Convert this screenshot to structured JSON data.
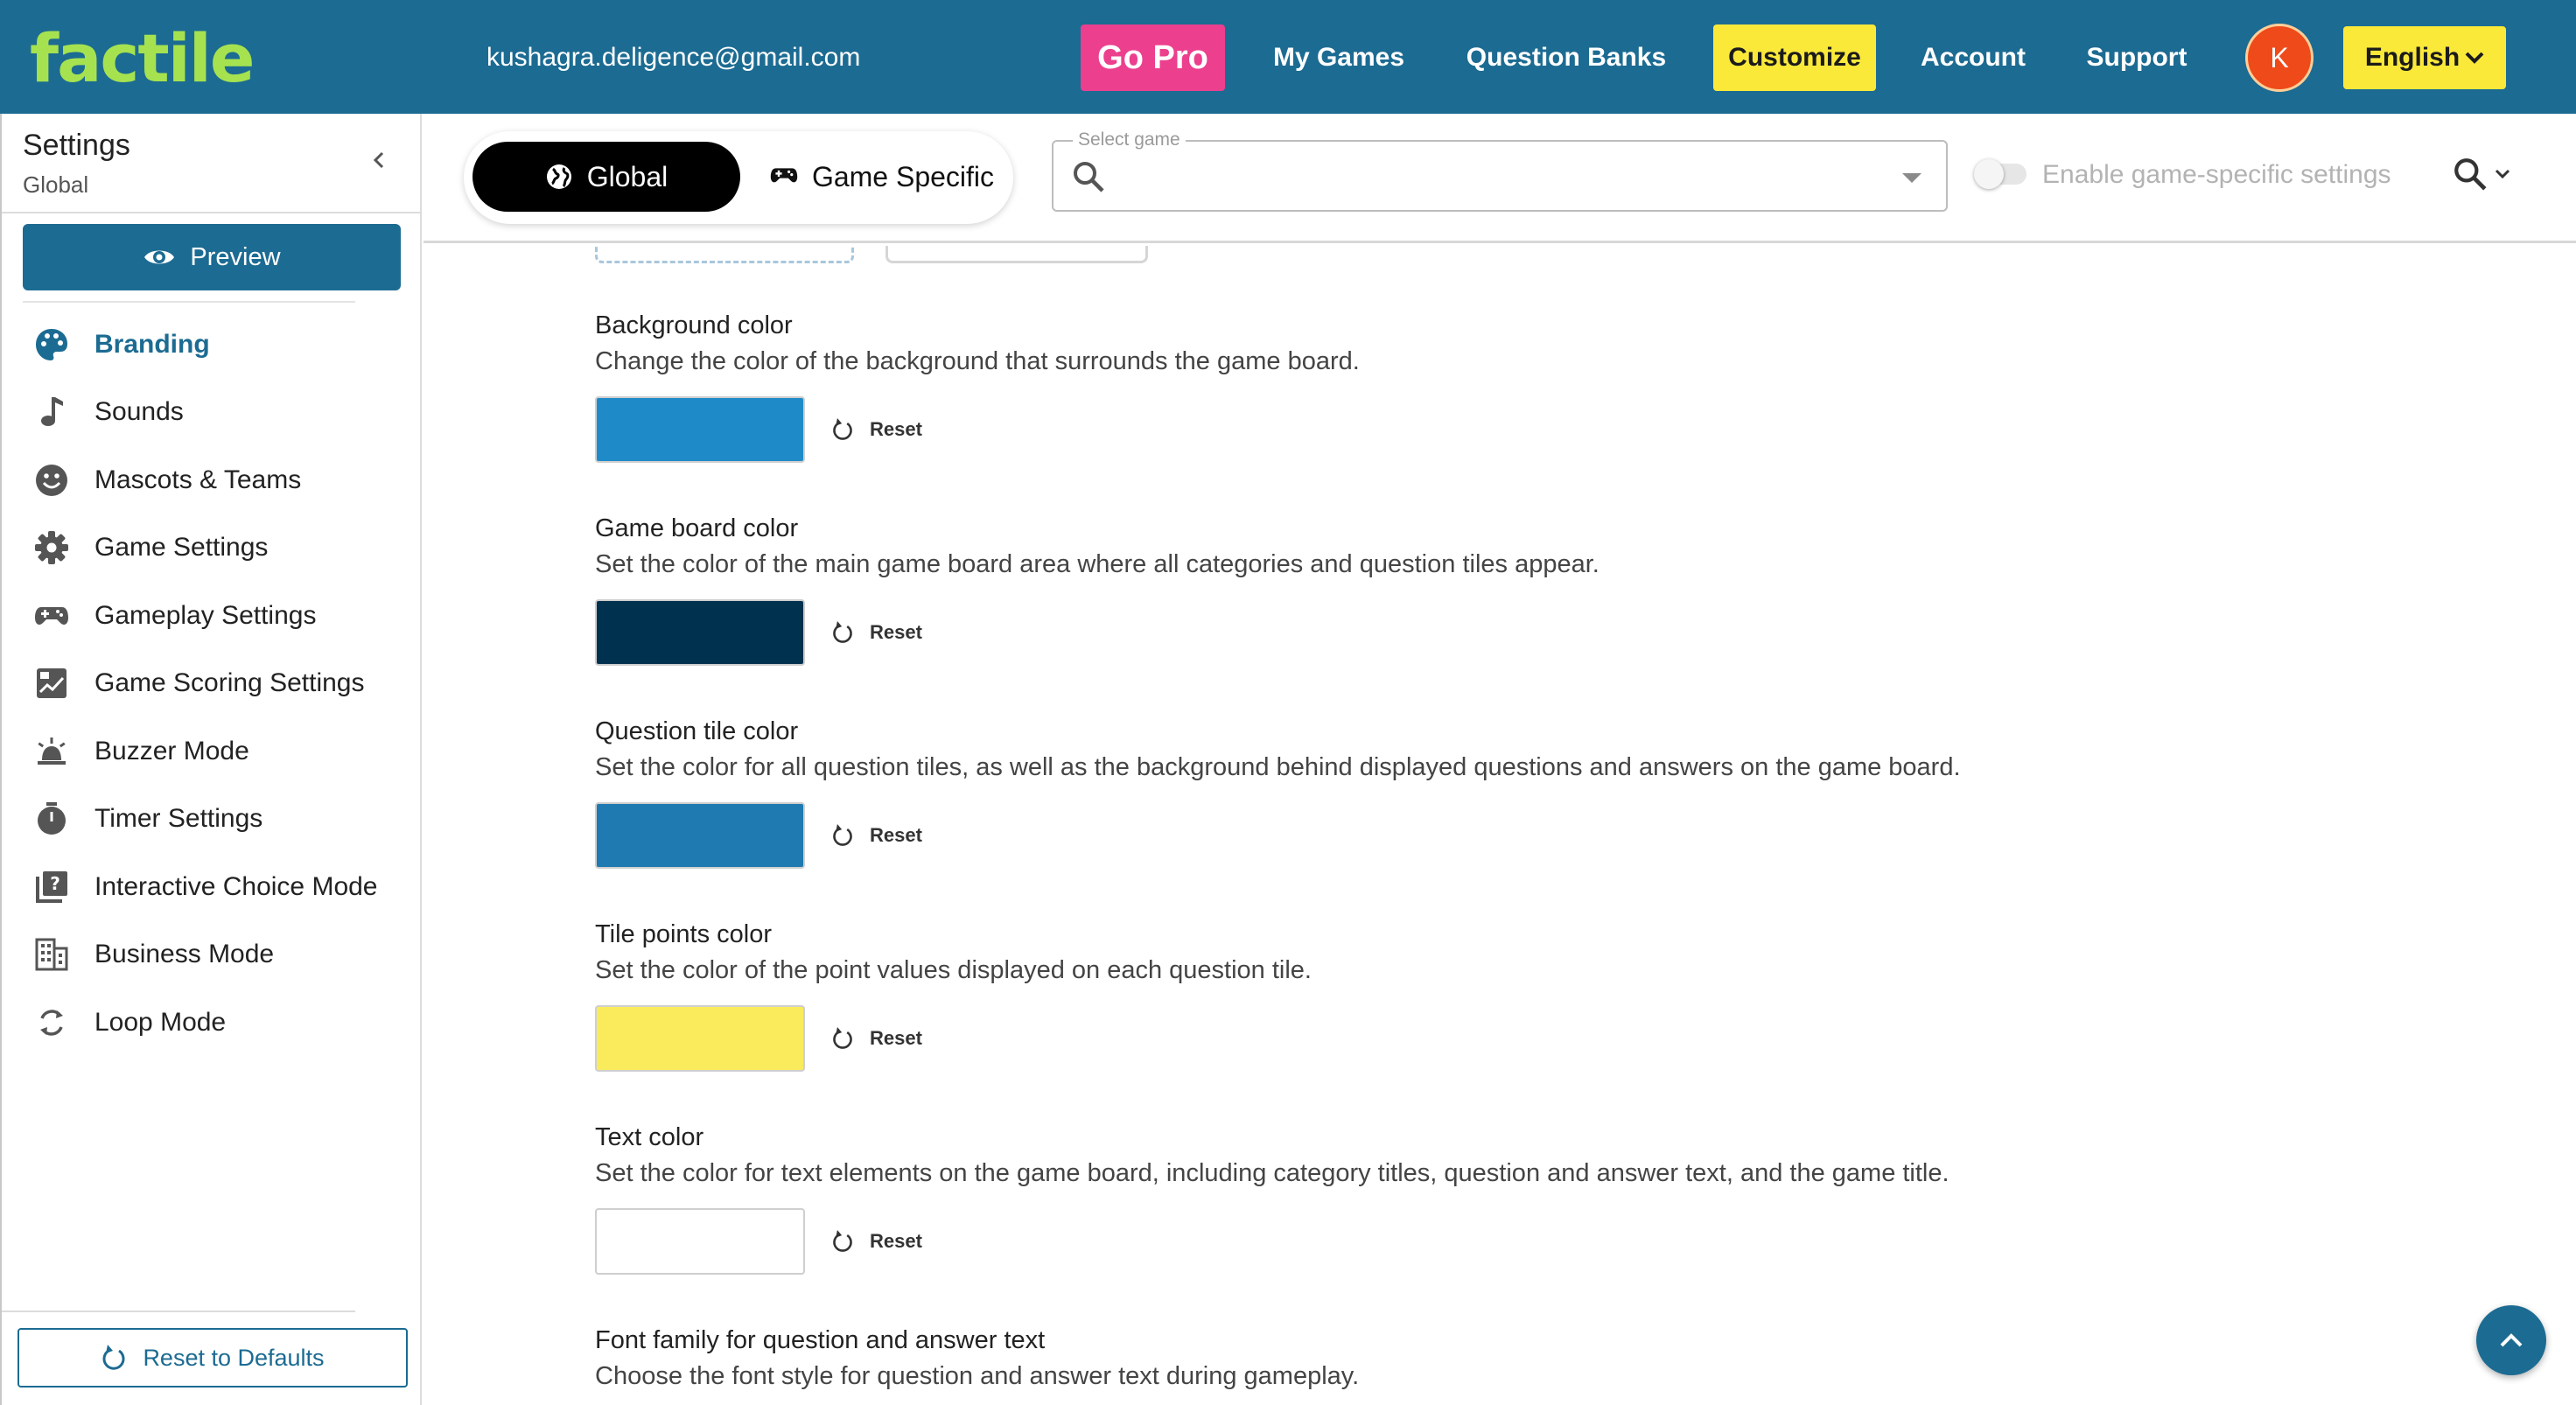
{
  "app": {
    "logo_text": "factile",
    "user_email": "kushagra.deligence@gmail.com"
  },
  "nav": {
    "go_pro": "Go Pro",
    "my_games": "My Games",
    "question_banks": "Question Banks",
    "customize": "Customize",
    "account": "Account",
    "support": "Support",
    "avatar_initial": "K",
    "language": "English"
  },
  "sidebar": {
    "title": "Settings",
    "subtitle": "Global",
    "preview_label": "Preview",
    "items": [
      {
        "label": "Branding",
        "icon": "palette-icon"
      },
      {
        "label": "Sounds",
        "icon": "music-note-icon"
      },
      {
        "label": "Mascots & Teams",
        "icon": "smiley-face-icon"
      },
      {
        "label": "Game Settings",
        "icon": "gear-icon"
      },
      {
        "label": "Gameplay Settings",
        "icon": "gamepad-icon"
      },
      {
        "label": "Game Scoring Settings",
        "icon": "scoreboard-icon"
      },
      {
        "label": "Buzzer Mode",
        "icon": "buzzer-bell-icon"
      },
      {
        "label": "Timer Settings",
        "icon": "stopwatch-icon"
      },
      {
        "label": "Interactive Choice Mode",
        "icon": "question-stack-icon"
      },
      {
        "label": "Business Mode",
        "icon": "building-icon"
      },
      {
        "label": "Loop Mode",
        "icon": "loop-arrows-icon"
      }
    ],
    "active_index": 0,
    "reset_label": "Reset to Defaults"
  },
  "toolbar": {
    "global_label": "Global",
    "specific_label": "Game Specific",
    "select_game_label": "Select game",
    "enable_label": "Enable game-specific settings"
  },
  "settings": [
    {
      "title": "Background color",
      "description": "Change the color of the background that surrounds the game board.",
      "color": "#1f8ac8",
      "reset_label": "Reset"
    },
    {
      "title": "Game board color",
      "description": "Set the color of the main game board area where all categories and question tiles appear.",
      "color": "#00324f",
      "reset_label": "Reset"
    },
    {
      "title": "Question tile color",
      "description": "Set the color for all question tiles, as well as the background behind displayed questions and answers on the game board.",
      "color": "#1f7ab1",
      "reset_label": "Reset"
    },
    {
      "title": "Tile points color",
      "description": "Set the color of the point values displayed on each question tile.",
      "color": "#faeb5c",
      "reset_label": "Reset"
    },
    {
      "title": "Text color",
      "description": "Set the color for text elements on the game board, including category titles, question and answer text, and the game title.",
      "color": "#ffffff",
      "reset_label": "Reset"
    },
    {
      "title": "Font family for question and answer text",
      "description": "Choose the font style for question and answer text during gameplay."
    }
  ],
  "colors": {
    "brand_blue": "#1c6b92",
    "go_pro_pink": "#ec3f8e",
    "highlight_yellow": "#fbe93a",
    "logo_green": "#a6e24f",
    "avatar_orange": "#ef4a1a"
  }
}
